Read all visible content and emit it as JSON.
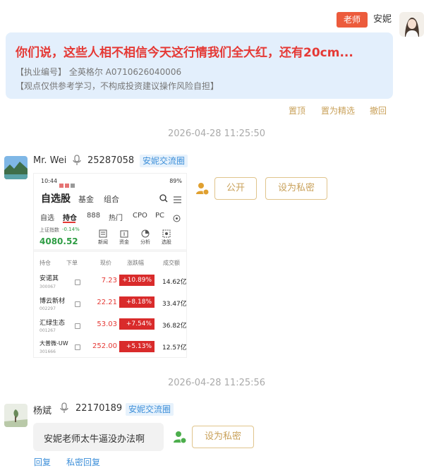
{
  "teacher": {
    "badge": "老师",
    "name": "安妮",
    "message_title": "你们说，这些人相不相信今天这行情我们全大红，还有20cm...",
    "license": "【执业编号】 全英格尔 A0710626040006",
    "disclaimer": "【观点仅供参考学习，不构成投资建议操作风险自担】",
    "actions": [
      "置顶",
      "置为精选",
      "撤回"
    ]
  },
  "messages": [
    {
      "timestamp": "2026-04-28 11:25:50",
      "user": "Mr. Wei",
      "uid": "25287058",
      "group": "安妮交流圈",
      "buttons": {
        "public": "公开",
        "private": "设为私密"
      }
    },
    {
      "timestamp": "2026-04-28 11:25:56",
      "user": "杨斌",
      "uid": "22170189",
      "group": "安妮交流圈",
      "text": "安妮老师太牛逼没办法啊",
      "buttons": {
        "private": "设为私密"
      },
      "links": {
        "reply": "回复",
        "private_reply": "私密回复"
      }
    }
  ],
  "phone_screenshot": {
    "status_time": "10:44",
    "status_right": "89%",
    "tabs": [
      "自选股",
      "基金",
      "组合"
    ],
    "sub_tabs": [
      "自选",
      "持仓",
      "888",
      "热门",
      "CPO",
      "PC"
    ],
    "index_label": "上证指数",
    "index_change": "-0.14%",
    "index_value": "4080.52",
    "tools": [
      "新闻",
      "资金",
      "分析",
      "选股"
    ],
    "columns": [
      "持仓",
      "下单",
      "现价",
      "涨跌幅",
      "成交额"
    ],
    "rows": [
      {
        "name": "安诺其",
        "code": "300067",
        "price": "7.23",
        "change": "+10.89%",
        "amount": "14.62亿"
      },
      {
        "name": "博云新材",
        "code": "002297",
        "price": "22.21",
        "change": "+8.18%",
        "amount": "33.47亿"
      },
      {
        "name": "汇绿生态",
        "code": "001267",
        "price": "53.03",
        "change": "+7.54%",
        "amount": "36.82亿"
      },
      {
        "name": "大普微-UW",
        "code": "301666",
        "price": "252.00",
        "change": "+5.13%",
        "amount": "12.57亿"
      }
    ]
  },
  "colors": {
    "accent": "#c9a15a",
    "badge": "#ec5b3c",
    "red": "#e53935",
    "link": "#3d8fd9"
  }
}
